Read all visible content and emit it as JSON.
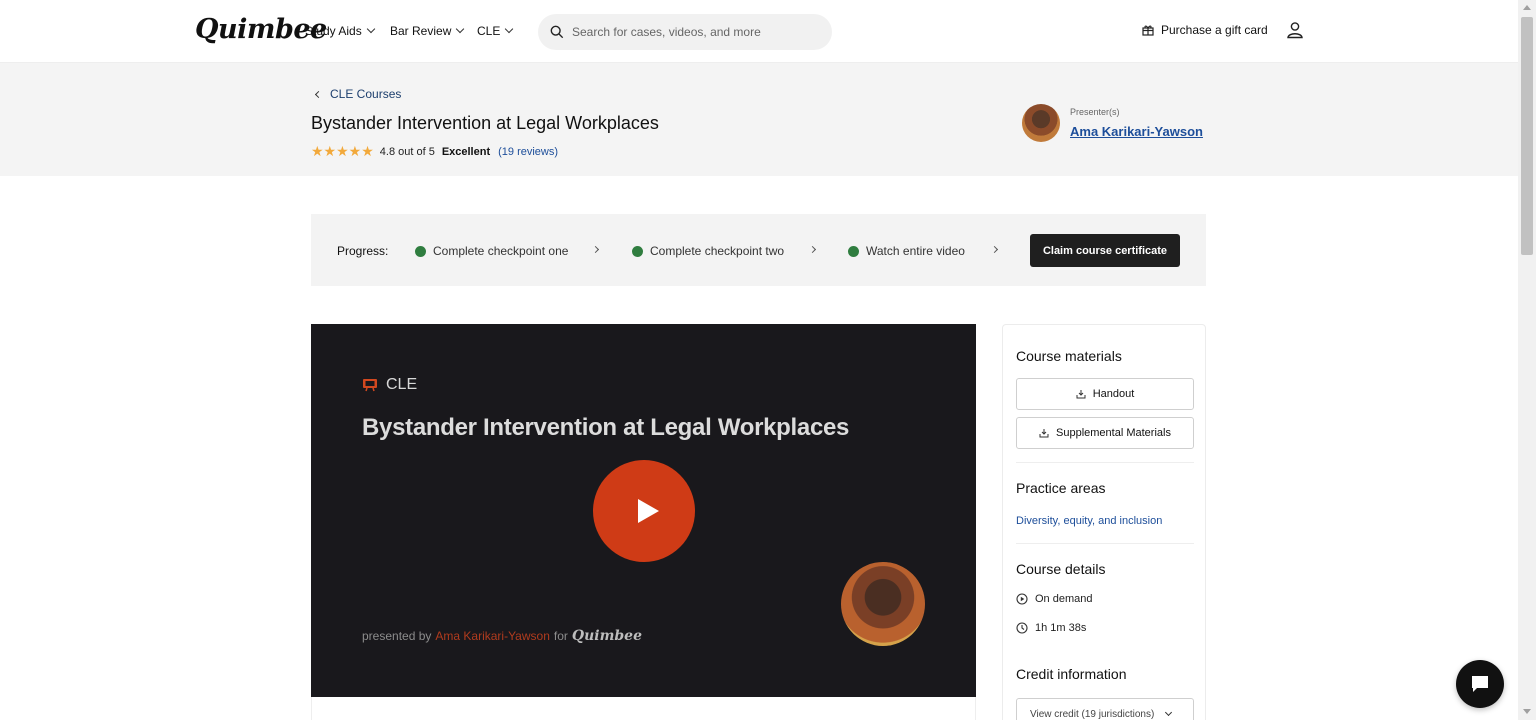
{
  "header": {
    "logo": "Quimbee",
    "nav": [
      {
        "label": "Study Aids"
      },
      {
        "label": "Bar Review"
      },
      {
        "label": "CLE"
      }
    ],
    "search_placeholder": "Search for cases, videos, and more",
    "gift_label": "Purchase a gift card"
  },
  "course": {
    "breadcrumb": "CLE Courses",
    "title": "Bystander Intervention at Legal Workplaces",
    "stars": "★★★★★",
    "rating_text": "4.8 out of 5",
    "rating_label": "Excellent",
    "reviews": "(19 reviews)",
    "presenter_label": "Presenter(s)",
    "presenter_name": "Ama Karikari-Yawson"
  },
  "progress": {
    "label": "Progress:",
    "steps": [
      {
        "label": "Complete checkpoint one"
      },
      {
        "label": "Complete checkpoint two"
      },
      {
        "label": "Watch entire video"
      }
    ],
    "claim_label": "Claim course certificate"
  },
  "video": {
    "tag": "CLE",
    "title": "Bystander Intervention at Legal Workplaces",
    "presented_by": "presented by",
    "presenter": "Ama Karikari-Yawson",
    "for_text": "for",
    "brand": "Quimbee"
  },
  "sidebar": {
    "materials_title": "Course materials",
    "materials": [
      {
        "label": "Handout"
      },
      {
        "label": "Supplemental Materials"
      }
    ],
    "practice_title": "Practice areas",
    "practice_link": "Diversity, equity, and inclusion",
    "details_title": "Course details",
    "details": [
      {
        "label": "On demand",
        "icon": "play-circle-icon"
      },
      {
        "label": "1h 1m 38s",
        "icon": "clock-icon"
      }
    ],
    "credit_title": "Credit information",
    "credit_select": "View credit (19 jurisdictions)"
  },
  "colors": {
    "accent_red": "#cf3b16",
    "link_blue": "#1d4e9a",
    "checkpoint_green": "#2f7d3f",
    "star": "#f2a93b"
  }
}
